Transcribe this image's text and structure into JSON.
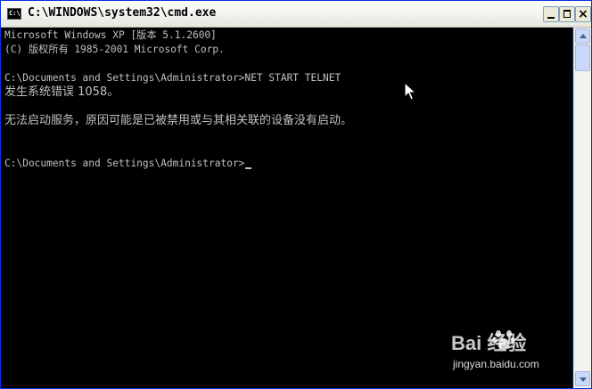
{
  "window": {
    "title": "C:\\WINDOWS\\system32\\cmd.exe",
    "icon_label": "C:\\",
    "controls": {
      "minimize": "minimize",
      "maximize": "maximize",
      "close": "×"
    }
  },
  "console": {
    "lines": [
      "Microsoft Windows XP [版本 5.1.2600]",
      "(C) 版权所有 1985-2001 Microsoft Corp.",
      "",
      "C:\\Documents and Settings\\Administrator>NET START TELNET",
      "发生系统错误 1058。",
      "",
      "无法启动服务，原因可能是已被禁用或与其相关联的设备没有启动。",
      "",
      "",
      "C:\\Documents and Settings\\Administrator>"
    ],
    "text_color": "#c0c0c0",
    "background": "#000000"
  },
  "watermark": {
    "logo": "Bai  经验",
    "site": "jingyan.baidu.com"
  }
}
